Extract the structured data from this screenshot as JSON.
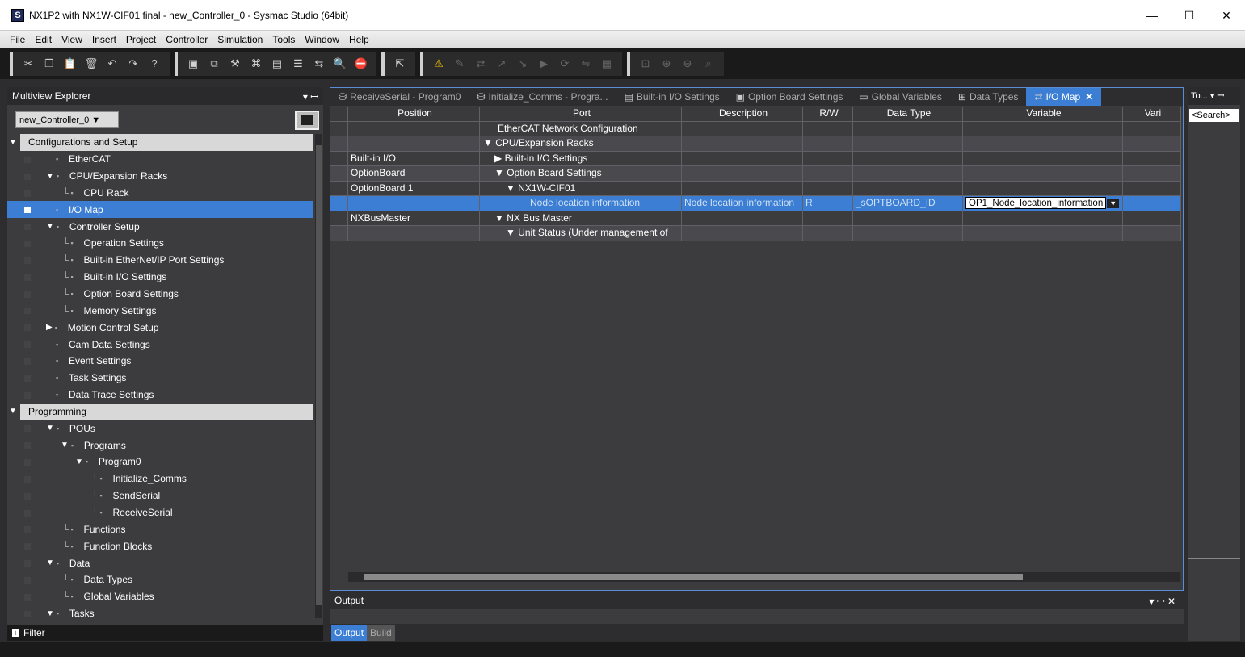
{
  "window": {
    "title": "NX1P2 with NX1W-CIF01 final - new_Controller_0 - Sysmac Studio (64bit)",
    "app_icon": "S",
    "minimize": "—",
    "maximize": "☐",
    "close": "✕"
  },
  "menu": [
    "File",
    "Edit",
    "View",
    "Insert",
    "Project",
    "Controller",
    "Simulation",
    "Tools",
    "Window",
    "Help"
  ],
  "explorer": {
    "title": "Multiview Explorer",
    "controller": "new_Controller_0 ▼",
    "filter_label": "Filter",
    "pin": "▾ ꟷ"
  },
  "tree": [
    {
      "label": "Configurations and Setup",
      "type": "cat"
    },
    {
      "label": "EtherCAT",
      "indent": 60
    },
    {
      "label": "CPU/Expansion Racks",
      "indent": 48,
      "arrow": "▼"
    },
    {
      "label": "CPU Rack",
      "indent": 68,
      "branch": "└"
    },
    {
      "label": "I/O Map",
      "indent": 60,
      "selected": true
    },
    {
      "label": "Controller Setup",
      "indent": 48,
      "arrow": "▼"
    },
    {
      "label": "Operation Settings",
      "indent": 68,
      "branch": "└"
    },
    {
      "label": "Built-in EtherNet/IP Port Settings",
      "indent": 68,
      "branch": "└"
    },
    {
      "label": "Built-in I/O Settings",
      "indent": 68,
      "branch": "└"
    },
    {
      "label": "Option Board Settings",
      "indent": 68,
      "branch": "└"
    },
    {
      "label": "Memory Settings",
      "indent": 68,
      "branch": "└"
    },
    {
      "label": "Motion Control Setup",
      "indent": 48,
      "arrow": "▶"
    },
    {
      "label": "Cam Data Settings",
      "indent": 60
    },
    {
      "label": "Event Settings",
      "indent": 60
    },
    {
      "label": "Task Settings",
      "indent": 60
    },
    {
      "label": "Data Trace Settings",
      "indent": 60
    },
    {
      "label": "Programming",
      "type": "cat"
    },
    {
      "label": "POUs",
      "indent": 48,
      "arrow": "▼"
    },
    {
      "label": "Programs",
      "indent": 66,
      "arrow": "▼"
    },
    {
      "label": "Program0",
      "indent": 84,
      "arrow": "▼"
    },
    {
      "label": "Initialize_Comms",
      "indent": 104,
      "branch": "└"
    },
    {
      "label": "SendSerial",
      "indent": 104,
      "branch": "└"
    },
    {
      "label": "ReceiveSerial",
      "indent": 104,
      "branch": "└"
    },
    {
      "label": "Functions",
      "indent": 68,
      "branch": "└"
    },
    {
      "label": "Function Blocks",
      "indent": 68,
      "branch": "└"
    },
    {
      "label": "Data",
      "indent": 48,
      "arrow": "▼"
    },
    {
      "label": "Data Types",
      "indent": 68,
      "branch": "└"
    },
    {
      "label": "Global Variables",
      "indent": 68,
      "branch": "└"
    },
    {
      "label": "Tasks",
      "indent": 48,
      "arrow": "▼"
    }
  ],
  "tabs": [
    {
      "label": "ReceiveSerial - Program0",
      "icon": "⛁"
    },
    {
      "label": "Initialize_Comms - Progra...",
      "icon": "⛁"
    },
    {
      "label": "Built-in I/O Settings",
      "icon": "▤"
    },
    {
      "label": "Option Board Settings",
      "icon": "▣"
    },
    {
      "label": "Global Variables",
      "icon": "▭"
    },
    {
      "label": "Data Types",
      "icon": "⊞"
    },
    {
      "label": "I/O Map",
      "icon": "⇄",
      "active": true,
      "close": "✕"
    }
  ],
  "grid": {
    "headers": [
      "Position",
      "Port",
      "Description",
      "R/W",
      "Data Type",
      "Variable",
      "Vari"
    ],
    "rows": [
      {
        "position": "",
        "port": "EtherCAT Network Configuration",
        "port_indent": 22,
        "style": "plain"
      },
      {
        "position": "",
        "port": "▼  CPU/Expansion Racks",
        "port_indent": 4,
        "style": "alt"
      },
      {
        "position": "Built-in I/O",
        "port": "▶   Built-in I/O Settings",
        "port_indent": 18,
        "style": "plain"
      },
      {
        "position": "OptionBoard",
        "port": "▼   Option Board Settings",
        "port_indent": 18,
        "style": "alt"
      },
      {
        "position": "OptionBoard 1",
        "port": "▼   NX1W-CIF01",
        "port_indent": 32,
        "style": "plain"
      },
      {
        "position": "",
        "port": "Node location information",
        "port_indent": 62,
        "description": "Node location information",
        "rw": "R",
        "datatype": "_sOPTBOARD_ID",
        "variable": "OP1_Node_location_information",
        "style": "sel"
      },
      {
        "position": "NXBusMaster",
        "port": "▼   NX Bus Master",
        "port_indent": 18,
        "style": "plain"
      },
      {
        "position": "",
        "port": "▼      Unit Status (Under management of",
        "port_indent": 32,
        "style": "alt"
      }
    ]
  },
  "output": {
    "title": "Output",
    "controls": "▾ ꟷ ✕"
  },
  "bottom_tabs": [
    "Output",
    "Build"
  ],
  "toolbox": {
    "title": "To... ▾ ꟷ",
    "search": "<Search>"
  }
}
